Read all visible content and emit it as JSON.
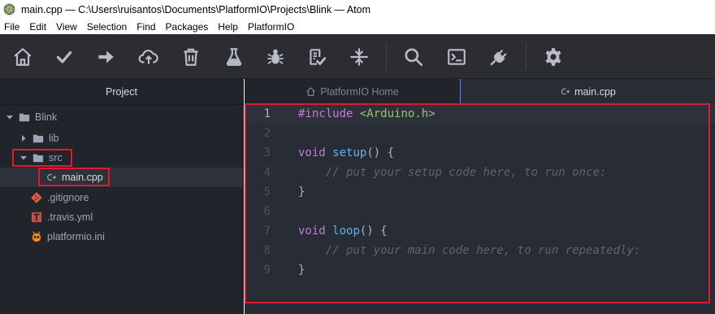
{
  "window": {
    "title": "main.cpp — C:\\Users\\ruisantos\\Documents\\PlatformIO\\Projects\\Blink — Atom",
    "app_icon": "atom-icon"
  },
  "menu": [
    "File",
    "Edit",
    "View",
    "Selection",
    "Find",
    "Packages",
    "Help",
    "PlatformIO"
  ],
  "toolbar": [
    {
      "name": "home-icon"
    },
    {
      "name": "check-icon"
    },
    {
      "name": "arrow-right-icon"
    },
    {
      "name": "cloud-upload-icon"
    },
    {
      "name": "trash-icon"
    },
    {
      "name": "flask-icon"
    },
    {
      "name": "bug-icon"
    },
    {
      "name": "clipboard-check-icon"
    },
    {
      "name": "serial-monitor-icon"
    },
    {
      "name": "search-icon"
    },
    {
      "name": "terminal-icon"
    },
    {
      "name": "plug-icon"
    },
    {
      "name": "gear-icon"
    }
  ],
  "sidebar": {
    "header": "Project",
    "tree": [
      {
        "label": "Blink",
        "icon": "folder-icon",
        "expanded": true
      },
      {
        "label": "lib",
        "icon": "folder-icon",
        "expanded": false
      },
      {
        "label": "src",
        "icon": "folder-icon",
        "expanded": true
      },
      {
        "label": "main.cpp",
        "icon": "cpp-file-icon",
        "selected": true
      },
      {
        "label": ".gitignore",
        "icon": "git-icon"
      },
      {
        "label": ".travis.yml",
        "icon": "travis-icon"
      },
      {
        "label": "platformio.ini",
        "icon": "platformio-ant-icon"
      }
    ]
  },
  "tabs": [
    {
      "label": "PlatformIO Home",
      "icon": "home-icon",
      "active": false
    },
    {
      "label": "main.cpp",
      "icon": "cpp-file-icon",
      "active": true
    }
  ],
  "editor": {
    "line_numbers": [
      "1",
      "2",
      "3",
      "4",
      "5",
      "6",
      "7",
      "8",
      "9"
    ],
    "lines": [
      "#include <Arduino.h>",
      "",
      "void setup() {",
      "    // put your setup code here, to run once:",
      "}",
      "",
      "void loop() {",
      "    // put your main code here, to run repeatedly:",
      "}"
    ],
    "tokens": {
      "l1_kw": "#include",
      "l1_str": "<Arduino.h>",
      "l3_kw": "void",
      "l3_fn": "setup",
      "l3_rest": "() {",
      "l4_cm": "// put your setup code here, to run once:",
      "l5": "}",
      "l7_kw": "void",
      "l7_fn": "loop",
      "l7_rest": "() {",
      "l8_cm": "// put your main code here, to run repeatedly:",
      "l9": "}"
    }
  },
  "colors": {
    "annotation": "#e0192d",
    "keyword": "#c678dd",
    "string": "#98c379",
    "function": "#61afef",
    "comment": "#5c6370",
    "tab_indicator": "#528bff"
  }
}
